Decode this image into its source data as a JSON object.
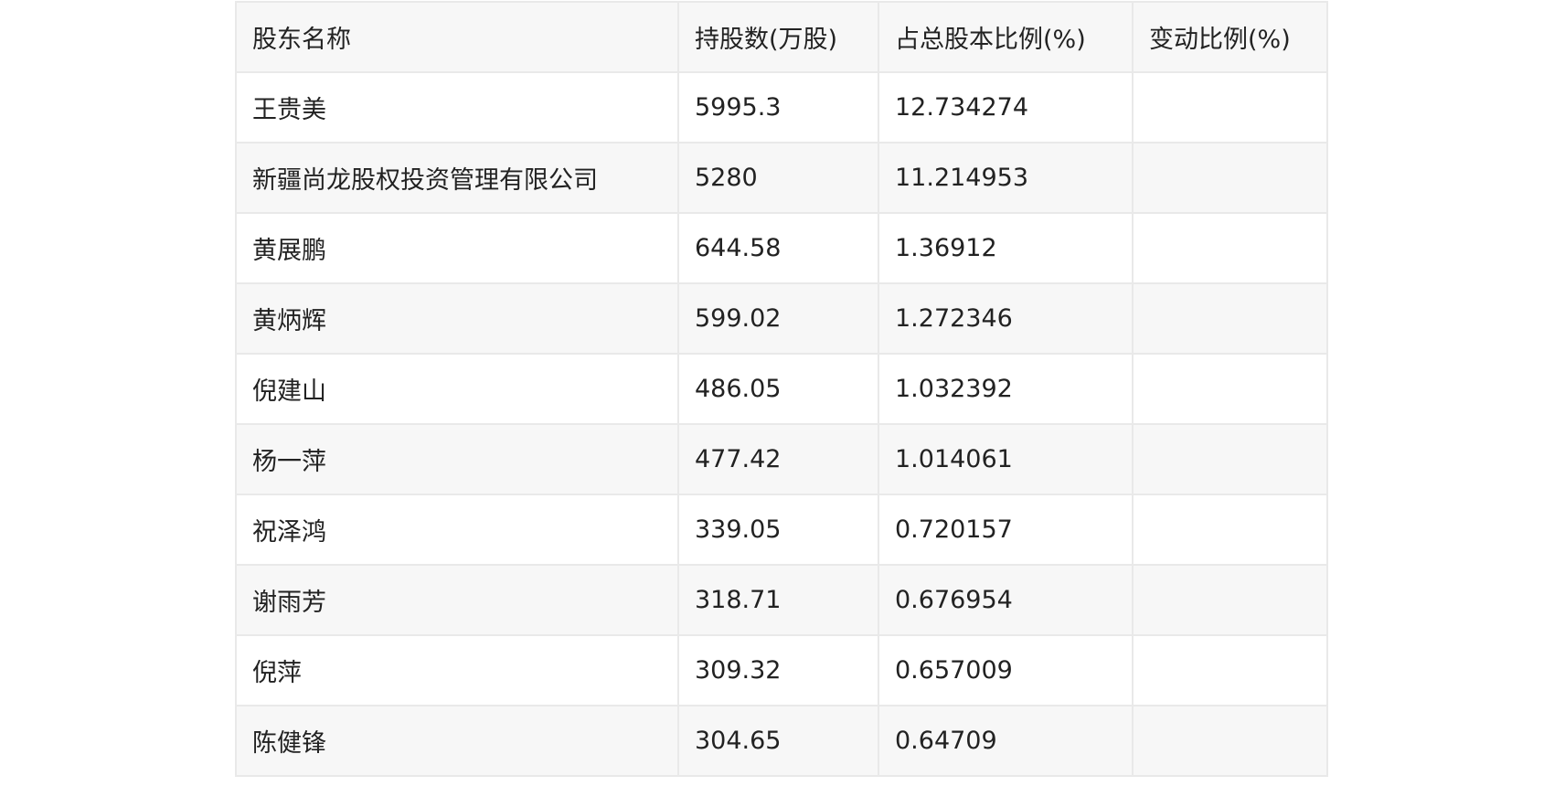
{
  "table": {
    "headers": [
      "股东名称",
      "持股数(万股)",
      "占总股本比例(%)",
      "变动比例(%)"
    ],
    "rows": [
      [
        "王贵美",
        "5995.3",
        "12.734274",
        ""
      ],
      [
        "新疆尚龙股权投资管理有限公司",
        "5280",
        "11.214953",
        ""
      ],
      [
        "黄展鹏",
        "644.58",
        "1.36912",
        ""
      ],
      [
        "黄炳辉",
        "599.02",
        "1.272346",
        ""
      ],
      [
        "倪建山",
        "486.05",
        "1.032392",
        ""
      ],
      [
        "杨一萍",
        "477.42",
        "1.014061",
        ""
      ],
      [
        "祝泽鸿",
        "339.05",
        "0.720157",
        ""
      ],
      [
        "谢雨芳",
        "318.71",
        "0.676954",
        ""
      ],
      [
        "倪萍",
        "309.32",
        "0.657009",
        ""
      ],
      [
        "陈健锋",
        "304.65",
        "0.64709",
        ""
      ]
    ]
  }
}
